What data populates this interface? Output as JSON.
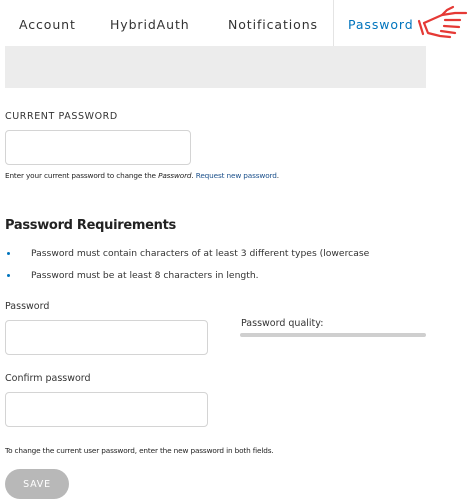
{
  "tabs": [
    {
      "label": "Account"
    },
    {
      "label": "HybridAuth"
    },
    {
      "label": "Notifications"
    },
    {
      "label": "Password",
      "active": true
    }
  ],
  "current_password": {
    "label": "CURRENT PASSWORD",
    "value": "",
    "description_before": "Enter your current password to change the ",
    "description_em": "Password",
    "description_after": ". ",
    "request_link": "Request new password"
  },
  "requirements": {
    "title": "Password Requirements",
    "items": [
      "Password must contain characters of at least 3 different types (lowercase",
      "Password must be at least 8 characters in length."
    ]
  },
  "password": {
    "label": "Password",
    "value": "",
    "quality_label": "Password quality:",
    "quality_level": 0
  },
  "confirm": {
    "label": "Confirm password",
    "value": ""
  },
  "footer_description": "To change the current user password, enter the new password in both fields.",
  "save_label": "SAVE",
  "colors": {
    "accent": "#0074bd",
    "hand_icon": "#e53935",
    "button": "#b8b8b8"
  }
}
